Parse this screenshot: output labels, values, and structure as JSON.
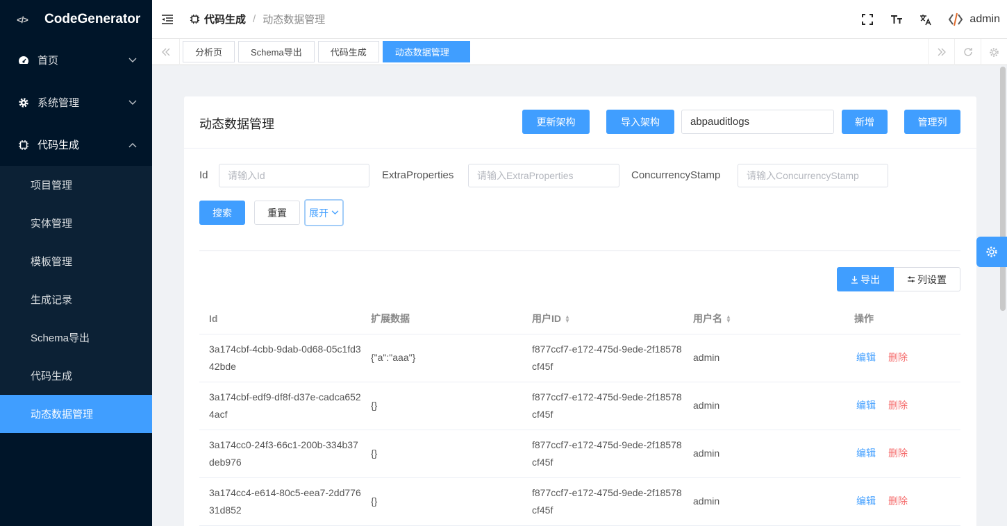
{
  "app": {
    "name": "CodeGenerator",
    "logo_text": "</>"
  },
  "sidebar": {
    "items": [
      {
        "label": "首页",
        "icon": "dashboard-icon"
      },
      {
        "label": "系统管理",
        "icon": "gear-icon"
      },
      {
        "label": "代码生成",
        "icon": "chip-icon"
      }
    ],
    "subitems": [
      "项目管理",
      "实体管理",
      "模板管理",
      "生成记录",
      "Schema导出",
      "代码生成",
      "动态数据管理"
    ],
    "active": "动态数据管理"
  },
  "header": {
    "breadcrumb": [
      "代码生成",
      "动态数据管理"
    ],
    "breadcrumb_sep": "/",
    "username": "admin"
  },
  "tabs": [
    "分析页",
    "Schema导出",
    "代码生成",
    "动态数据管理"
  ],
  "card": {
    "title": "动态数据管理",
    "btn_update_schema": "更新架构",
    "btn_import_schema": "导入架构",
    "schema_value": "abpauditlogs",
    "btn_add": "新增",
    "btn_manage_cols": "管理列"
  },
  "filters": {
    "id_label": "Id",
    "id_placeholder": "请输入Id",
    "extra_label": "ExtraProperties",
    "extra_placeholder": "请输入ExtraProperties",
    "stamp_label": "ConcurrencyStamp",
    "stamp_placeholder": "请输入ConcurrencyStamp",
    "btn_search": "搜索",
    "btn_reset": "重置",
    "btn_expand": "展开"
  },
  "toolbar": {
    "export": "导出",
    "column_settings": "列设置"
  },
  "table": {
    "headers": [
      "Id",
      "扩展数据",
      "用户ID",
      "用户名",
      "操作"
    ],
    "action_edit": "编辑",
    "action_delete": "删除",
    "rows": [
      {
        "id": "3a174cbf-4cbb-9dab-0d68-05c1fd342bde",
        "extra": "{\"a\":\"aaa\"}",
        "user_id": "f877ccf7-e172-475d-9ede-2f18578cf45f",
        "username": "admin"
      },
      {
        "id": "3a174cbf-edf9-df8f-d37e-cadca6524acf",
        "extra": "{}",
        "user_id": "f877ccf7-e172-475d-9ede-2f18578cf45f",
        "username": "admin"
      },
      {
        "id": "3a174cc0-24f3-66c1-200b-334b37deb976",
        "extra": "{}",
        "user_id": "f877ccf7-e172-475d-9ede-2f18578cf45f",
        "username": "admin"
      },
      {
        "id": "3a174cc4-e614-80c5-eea7-2dd77631d852",
        "extra": "{}",
        "user_id": "f877ccf7-e172-475d-9ede-2f18578cf45f",
        "username": "admin"
      }
    ]
  },
  "colors": {
    "primary": "#409eff",
    "sidebar_bg": "#001529",
    "danger": "#f56c6c"
  }
}
